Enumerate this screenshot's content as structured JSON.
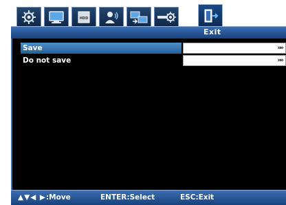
{
  "tabs": [
    {
      "icon": "gear-icon"
    },
    {
      "icon": "monitor-icon"
    },
    {
      "icon": "hdd-icon",
      "label": "HDD"
    },
    {
      "icon": "user-icon"
    },
    {
      "icon": "network-icon"
    },
    {
      "icon": "advanced-settings-icon"
    },
    {
      "icon": "exit-door-icon",
      "active": true
    }
  ],
  "page": {
    "title": "Exit"
  },
  "menu": {
    "items": [
      {
        "label": "Save",
        "selected": true,
        "arrow": "»»"
      },
      {
        "label": "Do not save",
        "selected": false,
        "arrow": "»»"
      }
    ]
  },
  "footer": {
    "move_keys": "▲▼◀ ▶",
    "move_label": ":Move",
    "select_hint": "ENTER:Select",
    "exit_hint": "ESC:Exit"
  },
  "colors": {
    "accent_blue": "#2a5e96",
    "band_blue": "#3a6db1",
    "panel_bg": "#000000"
  }
}
